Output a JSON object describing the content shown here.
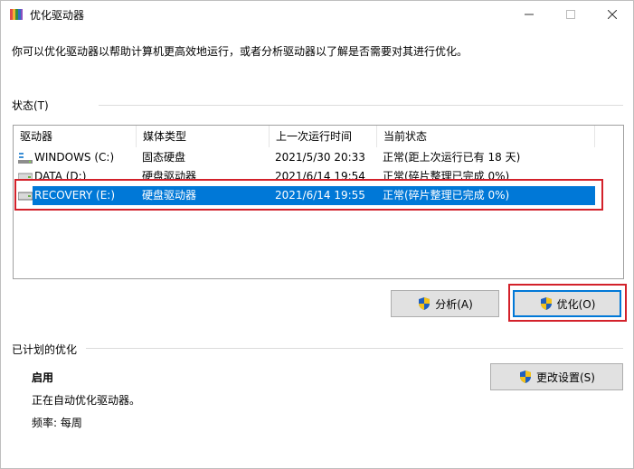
{
  "window": {
    "title": "优化驱动器"
  },
  "description": "你可以优化驱动器以帮助计算机更高效地运行，或者分析驱动器以了解是否需要对其进行优化。",
  "status_group": {
    "label": "状态(T)"
  },
  "table": {
    "columns": [
      "驱动器",
      "媒体类型",
      "上一次运行时间",
      "当前状态"
    ],
    "rows": [
      {
        "drive": "WINDOWS (C:)",
        "media": "固态硬盘",
        "last_run": "2021/5/30 20:33",
        "status": "正常(距上次运行已有 18 天)",
        "icon": "ssd-drive-icon"
      },
      {
        "drive": "DATA (D:)",
        "media": "硬盘驱动器",
        "last_run": "2021/6/14 19:54",
        "status": "正常(碎片整理已完成 0%)",
        "icon": "hdd-drive-icon"
      },
      {
        "drive": "RECOVERY (E:)",
        "media": "硬盘驱动器",
        "last_run": "2021/6/14 19:55",
        "status": "正常(碎片整理已完成 0%)",
        "icon": "hdd-drive-icon"
      }
    ]
  },
  "buttons": {
    "analyze": "分析(A)",
    "optimize": "优化(O)",
    "change_settings": "更改设置(S)"
  },
  "schedule_group": {
    "label": "已计划的优化",
    "state": "启用",
    "detail": "正在自动优化驱动器。",
    "frequency": "频率: 每周"
  },
  "colors": {
    "selection": "#0078d7",
    "highlight_box": "#d3212a"
  }
}
